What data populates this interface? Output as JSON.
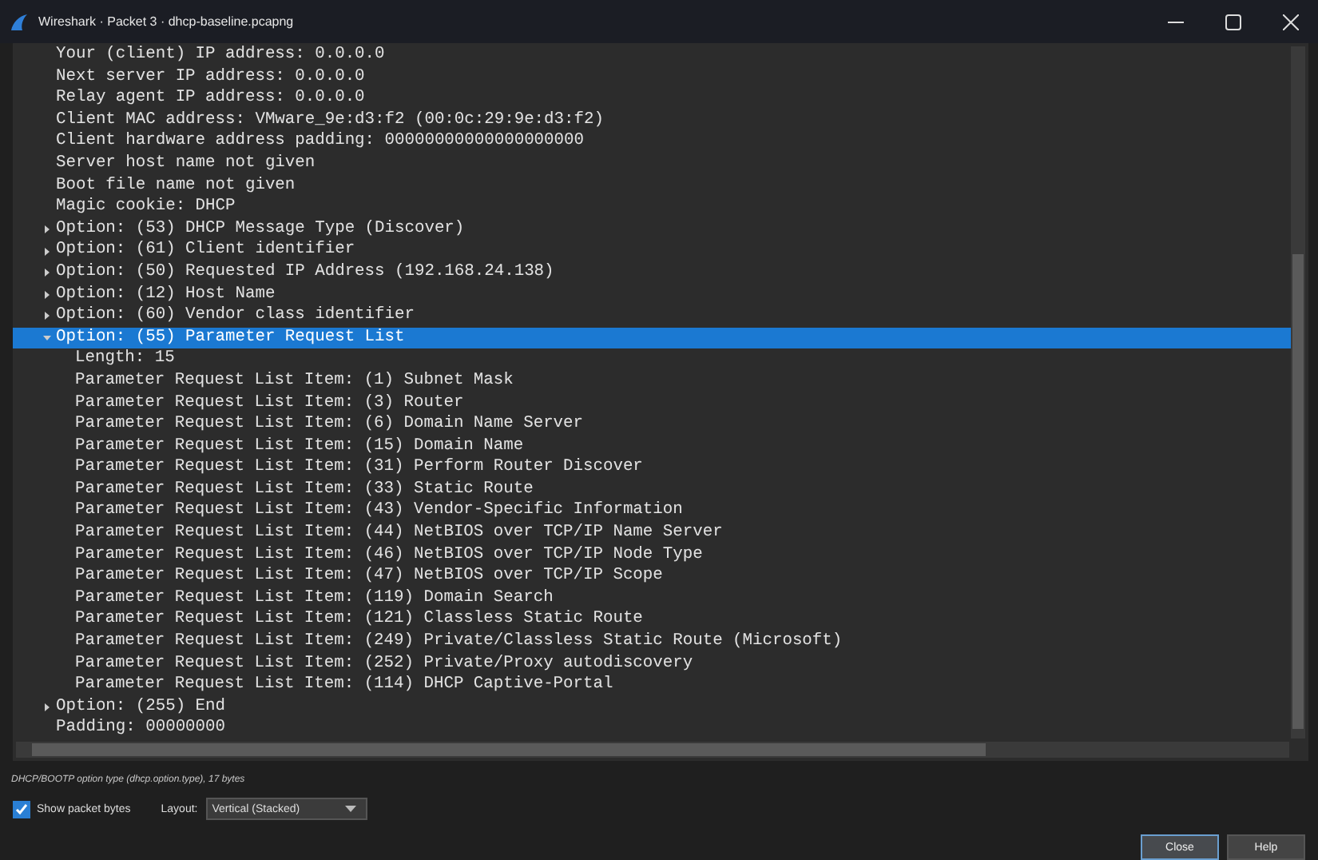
{
  "window": {
    "title": "Wireshark · Packet 3 · dhcp-baseline.pcapng"
  },
  "tree": [
    {
      "text": "Your (client) IP address: 0.0.0.0"
    },
    {
      "text": "Next server IP address: 0.0.0.0"
    },
    {
      "text": "Relay agent IP address: 0.0.0.0"
    },
    {
      "text": "Client MAC address: VMware_9e:d3:f2 (00:0c:29:9e:d3:f2)"
    },
    {
      "text": "Client hardware address padding: 00000000000000000000"
    },
    {
      "text": "Server host name not given"
    },
    {
      "text": "Boot file name not given"
    },
    {
      "text": "Magic cookie: DHCP"
    },
    {
      "text": "Option: (53) DHCP Message Type (Discover)",
      "expanded": false,
      "selected": false
    },
    {
      "text": "Option: (61) Client identifier",
      "expanded": false,
      "selected": false
    },
    {
      "text": "Option: (50) Requested IP Address (192.168.24.138)",
      "expanded": false,
      "selected": false
    },
    {
      "text": "Option: (12) Host Name",
      "expanded": false,
      "selected": false
    },
    {
      "text": "Option: (60) Vendor class identifier",
      "expanded": false,
      "selected": false
    },
    {
      "text": "Option: (55) Parameter Request List",
      "expanded": true,
      "selected": true,
      "children": [
        {
          "text": "Length: 15"
        },
        {
          "text": "Parameter Request List Item: (1) Subnet Mask"
        },
        {
          "text": "Parameter Request List Item: (3) Router"
        },
        {
          "text": "Parameter Request List Item: (6) Domain Name Server"
        },
        {
          "text": "Parameter Request List Item: (15) Domain Name"
        },
        {
          "text": "Parameter Request List Item: (31) Perform Router Discover"
        },
        {
          "text": "Parameter Request List Item: (33) Static Route"
        },
        {
          "text": "Parameter Request List Item: (43) Vendor-Specific Information"
        },
        {
          "text": "Parameter Request List Item: (44) NetBIOS over TCP/IP Name Server"
        },
        {
          "text": "Parameter Request List Item: (46) NetBIOS over TCP/IP Node Type"
        },
        {
          "text": "Parameter Request List Item: (47) NetBIOS over TCP/IP Scope"
        },
        {
          "text": "Parameter Request List Item: (119) Domain Search"
        },
        {
          "text": "Parameter Request List Item: (121) Classless Static Route"
        },
        {
          "text": "Parameter Request List Item: (249) Private/Classless Static Route (Microsoft)"
        },
        {
          "text": "Parameter Request List Item: (252) Private/Proxy autodiscovery"
        },
        {
          "text": "Parameter Request List Item: (114) DHCP Captive-Portal"
        }
      ]
    },
    {
      "text": "Option: (255) End",
      "expanded": false,
      "selected": false
    },
    {
      "text": "Padding: 00000000"
    }
  ],
  "status_text": "DHCP/BOOTP option type (dhcp.option.type), 17 bytes",
  "show_packet_bytes": {
    "label": "Show packet bytes",
    "checked": true
  },
  "layout": {
    "label": "Layout:",
    "value": "Vertical (Stacked)"
  },
  "buttons": [
    {
      "label": "Close",
      "default": true
    },
    {
      "label": "Help",
      "default": false
    }
  ]
}
